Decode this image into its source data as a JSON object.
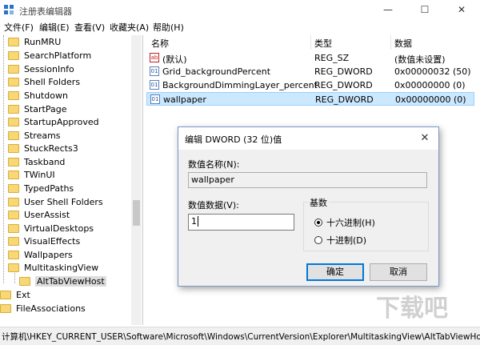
{
  "window": {
    "title": "注册表编辑器",
    "minimize": "—",
    "maximize": "☐",
    "close": "✕"
  },
  "menu": [
    "文件(F)",
    "编辑(E)",
    "查看(V)",
    "收藏夹(A)",
    "帮助(H)"
  ],
  "tree": {
    "items": [
      "RunMRU",
      "SearchPlatform",
      "SessionInfo",
      "Shell Folders",
      "Shutdown",
      "StartPage",
      "StartupApproved",
      "Streams",
      "StuckRects3",
      "Taskband",
      "TWinUI",
      "TypedPaths",
      "User Shell Folders",
      "UserAssist",
      "VirtualDesktops",
      "VisualEffects",
      "Wallpapers",
      "MultitaskingView"
    ],
    "selected_child": "AltTabViewHost",
    "root_items": [
      "Ext",
      "FileAssociations"
    ]
  },
  "list": {
    "columns": [
      "名称",
      "类型",
      "数据"
    ],
    "rows": [
      {
        "name": "(默认)",
        "type": "REG_SZ",
        "data": "(数值未设置)",
        "icon": "ab-string-icon"
      },
      {
        "name": "Grid_backgroundPercent",
        "type": "REG_DWORD",
        "data": "0x00000032 (50)",
        "icon": "binary-value-icon"
      },
      {
        "name": "BackgroundDimmingLayer_percent",
        "type": "REG_DWORD",
        "data": "0x00000000 (0)",
        "icon": "binary-value-icon"
      },
      {
        "name": "wallpaper",
        "type": "REG_DWORD",
        "data": "0x00000000 (0)",
        "icon": "binary-value-icon"
      }
    ],
    "selected_index": 3
  },
  "status": {
    "path": "计算机\\HKEY_CURRENT_USER\\Software\\Microsoft\\Windows\\CurrentVersion\\Explorer\\MultitaskingView\\AltTabViewHost"
  },
  "dialog": {
    "title": "编辑 DWORD (32 位)值",
    "close": "✕",
    "name_label": "数值名称(N):",
    "name_value": "wallpaper",
    "data_label": "数值数据(V):",
    "data_value": "1",
    "base_label": "基数",
    "base_options": [
      "十六进制(H)",
      "十进制(D)"
    ],
    "base_selected": 0,
    "ok": "确定",
    "cancel": "取消"
  },
  "watermark": "下载吧",
  "colors": {
    "selection": "#cce8ff",
    "folder": "#f8d775",
    "accent": "#0078d7"
  }
}
